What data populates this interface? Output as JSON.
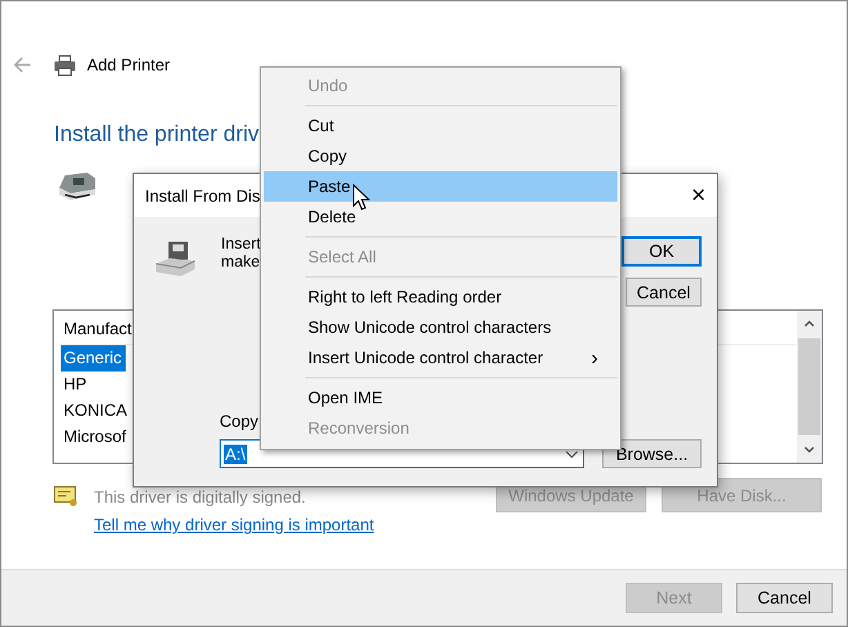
{
  "window": {
    "title": "Add Printer"
  },
  "heading": "Install the printer driv",
  "manufacturers": {
    "header": "Manufact",
    "items": [
      {
        "label": "Generic",
        "selected": true
      },
      {
        "label": "HP",
        "selected": false
      },
      {
        "label": "KONICA",
        "selected": false
      },
      {
        "label": "Microsof",
        "selected": false
      }
    ]
  },
  "signature": {
    "text": "This driver is digitally signed.",
    "link": "Tell me why driver signing is important"
  },
  "list_buttons": [
    {
      "label": "Windows Update",
      "disabled": true
    },
    {
      "label": "Have Disk...",
      "disabled": true
    }
  ],
  "footer_buttons": [
    {
      "label": "Next",
      "disabled": true
    },
    {
      "label": "Cancel",
      "disabled": false
    }
  ],
  "dialog": {
    "title": "Install From Dis",
    "close": "×",
    "message_lines": [
      "Insert",
      "make"
    ],
    "buttons": [
      {
        "label": "OK",
        "default": true
      },
      {
        "label": "Cancel",
        "default": false
      }
    ],
    "copy_label": "Copy",
    "path": {
      "value": "A:\\",
      "selected": true
    },
    "browse": "Browse..."
  },
  "context_menu": [
    {
      "kind": "item",
      "label": "Undo",
      "disabled": true,
      "selected": false
    },
    {
      "kind": "separator"
    },
    {
      "kind": "item",
      "label": "Cut",
      "disabled": false,
      "selected": false
    },
    {
      "kind": "item",
      "label": "Copy",
      "disabled": false,
      "selected": false
    },
    {
      "kind": "item",
      "label": "Paste",
      "disabled": false,
      "selected": true
    },
    {
      "kind": "item",
      "label": "Delete",
      "disabled": false,
      "selected": false
    },
    {
      "kind": "separator"
    },
    {
      "kind": "item",
      "label": "Select All",
      "disabled": true,
      "selected": false
    },
    {
      "kind": "separator"
    },
    {
      "kind": "item",
      "label": "Right to left Reading order",
      "disabled": false,
      "selected": false
    },
    {
      "kind": "item",
      "label": "Show Unicode control characters",
      "disabled": false,
      "selected": false
    },
    {
      "kind": "submenu",
      "label": "Insert Unicode control character",
      "arrow": "›",
      "disabled": false,
      "selected": false
    },
    {
      "kind": "separator"
    },
    {
      "kind": "item",
      "label": "Open IME",
      "disabled": false,
      "selected": false
    },
    {
      "kind": "item",
      "label": "Reconversion",
      "disabled": true,
      "selected": false
    }
  ]
}
